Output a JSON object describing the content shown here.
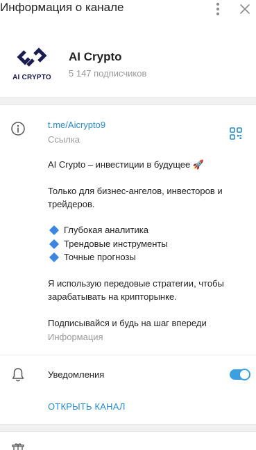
{
  "header": {
    "title": "Информация о канале",
    "icons": [
      "more-vertical-icon",
      "close-icon"
    ]
  },
  "profile": {
    "avatar_caption": "AI CRYPTO",
    "channel_name": "AI Crypto",
    "subscribers": "5 147 подписчиков",
    "avatar_color": "#1b1c4f"
  },
  "link": {
    "url": "t.me/Aicrypto9",
    "label": "Ссылка"
  },
  "description": {
    "line1": "AI Crypto – инвестиции в будущее",
    "line1_emoji": "🚀",
    "line2": "Только для бизнес-ангелов, инвесторов и",
    "line3": "трейдеров.",
    "bullets": [
      "Глубокая аналитика",
      "Трендовые инструменты",
      "Точные прогнозы"
    ],
    "line4": "Я использую передовые стратегии, чтобы",
    "line5": "зарабатывать на крипторынке.",
    "line6": "Подписывайся и будь на шаг впереди",
    "label": "Информация"
  },
  "notifications": {
    "label": "Уведомления",
    "enabled": true
  },
  "open_channel_label": "ОТКРЫТЬ КАНАЛ",
  "colors": {
    "accent": "#2a8bd0",
    "toggle": "#3ca0e0",
    "bullet": "#3d86e0",
    "muted": "#999999"
  }
}
